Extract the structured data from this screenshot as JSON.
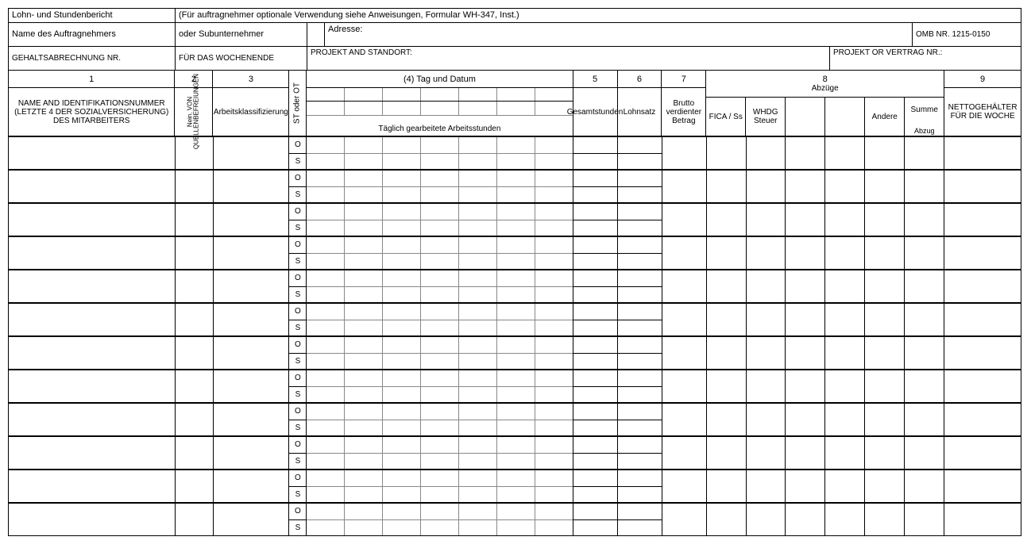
{
  "header": {
    "title": "Lohn- und Stundenbericht",
    "instructions": "(Für auftragnehmer optionale Verwendung siehe Anweisungen, Formular WH-347, Inst.)",
    "contractor_name_label": "Name des Auftragnehmers",
    "or_sub_label": "oder Subunternehmer",
    "address_label": "Adresse:",
    "omb": "OMB NR. 1215-0150",
    "payroll_no_label": "GEHALTSABRECHNUNG NR.",
    "week_ending_label": "FÜR DAS WOCHENENDE",
    "project_loc_label": "PROJEKT AND STANDORT:",
    "project_no_label": "PROJEKT OR VERTRAG NR.:"
  },
  "cols": {
    "c1_num": "1",
    "c1_label": "NAME AND IDENTIFIKATIONSNUMMER (LETZTE 4 DER SOZIALVERSICHERUNG) DES MITARBEITERS",
    "c2_num": "2",
    "c2_label": "Nein. VON QUELLENBEFREIUNGEN",
    "c3_num": "3",
    "c3_label": "Arbeitsklassifizierung",
    "c_ot_label": "ST oder OT",
    "c4_label": "(4) Tag und Datum",
    "c4_sub": "Täglich gearbeitete Arbeitsstunden",
    "c5_num": "5",
    "c5_label": "Gesamtstunden",
    "c6_num": "6",
    "c6_label": "Lohnsatz",
    "c7_num": "7",
    "c7_label": "Brutto verdienter Betrag",
    "c8_num": "8",
    "c8_label": "Abzüge",
    "c8_fica": "FICA / Ss",
    "c8_whdg": "WHDG Steuer",
    "c8_blank1": "",
    "c8_blank2": "",
    "c8_other": "Andere",
    "c8_total_top": "Summe",
    "c8_total_bot": "Abzug",
    "c9_num": "9",
    "c9_label": "NETTOGEHÄLTER FÜR DIE WOCHE"
  },
  "ot_rows": {
    "o": "O",
    "s": "S"
  },
  "data_row_count": 12
}
